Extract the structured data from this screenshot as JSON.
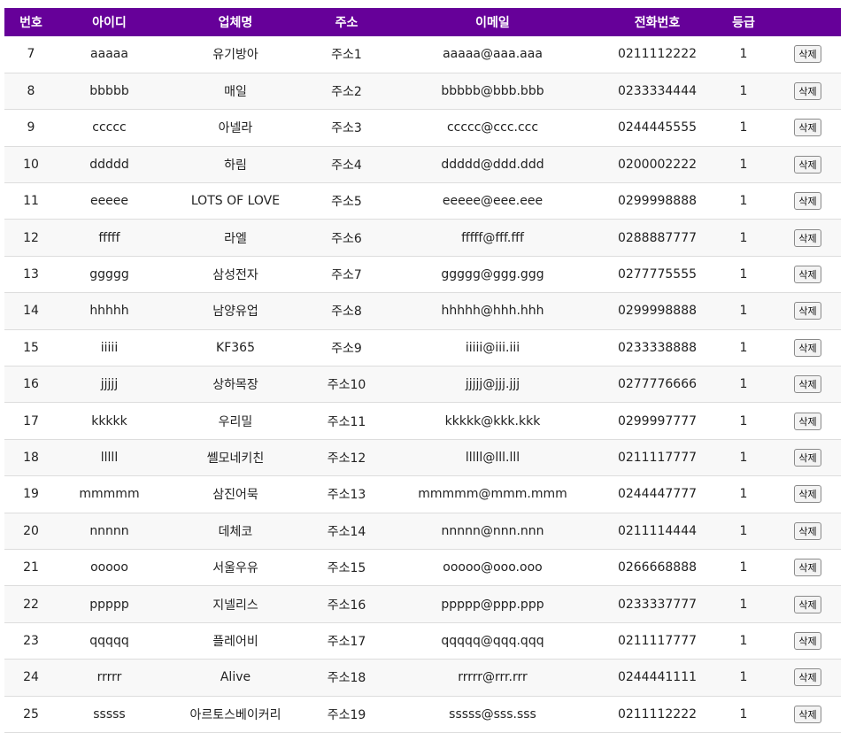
{
  "table": {
    "headers": [
      "번호",
      "아이디",
      "업체명",
      "주소",
      "이메일",
      "전화번호",
      "등급",
      ""
    ],
    "delete_label": "삭제",
    "rows": [
      {
        "no": "7",
        "id": "aaaaa",
        "company": "유기방아",
        "address": "주소1",
        "email": "aaaaa@aaa.aaa",
        "phone": "0211112222",
        "grade": "1"
      },
      {
        "no": "8",
        "id": "bbbbb",
        "company": "매일",
        "address": "주소2",
        "email": "bbbbb@bbb.bbb",
        "phone": "0233334444",
        "grade": "1"
      },
      {
        "no": "9",
        "id": "ccccc",
        "company": "아넬라",
        "address": "주소3",
        "email": "ccccc@ccc.ccc",
        "phone": "0244445555",
        "grade": "1"
      },
      {
        "no": "10",
        "id": "ddddd",
        "company": "하림",
        "address": "주소4",
        "email": "ddddd@ddd.ddd",
        "phone": "0200002222",
        "grade": "1"
      },
      {
        "no": "11",
        "id": "eeeee",
        "company": "LOTS OF LOVE",
        "address": "주소5",
        "email": "eeeee@eee.eee",
        "phone": "0299998888",
        "grade": "1"
      },
      {
        "no": "12",
        "id": "fffff",
        "company": "라엘",
        "address": "주소6",
        "email": "fffff@fff.fff",
        "phone": "0288887777",
        "grade": "1"
      },
      {
        "no": "13",
        "id": "ggggg",
        "company": "삼성전자",
        "address": "주소7",
        "email": "ggggg@ggg.ggg",
        "phone": "0277775555",
        "grade": "1"
      },
      {
        "no": "14",
        "id": "hhhhh",
        "company": "남양유업",
        "address": "주소8",
        "email": "hhhhh@hhh.hhh",
        "phone": "0299998888",
        "grade": "1"
      },
      {
        "no": "15",
        "id": "iiiii",
        "company": "KF365",
        "address": "주소9",
        "email": "iiiii@iii.iii",
        "phone": "0233338888",
        "grade": "1"
      },
      {
        "no": "16",
        "id": "jjjjj",
        "company": "상하목장",
        "address": "주소10",
        "email": "jjjjj@jjj.jjj",
        "phone": "0277776666",
        "grade": "1"
      },
      {
        "no": "17",
        "id": "kkkkk",
        "company": "우리밀",
        "address": "주소11",
        "email": "kkkkk@kkk.kkk",
        "phone": "0299997777",
        "grade": "1"
      },
      {
        "no": "18",
        "id": "lllll",
        "company": "쎌모네키친",
        "address": "주소12",
        "email": "lllll@lll.lll",
        "phone": "0211117777",
        "grade": "1"
      },
      {
        "no": "19",
        "id": "mmmmm",
        "company": "삼진어묵",
        "address": "주소13",
        "email": "mmmmm@mmm.mmm",
        "phone": "0244447777",
        "grade": "1"
      },
      {
        "no": "20",
        "id": "nnnnn",
        "company": "데체코",
        "address": "주소14",
        "email": "nnnnn@nnn.nnn",
        "phone": "0211114444",
        "grade": "1"
      },
      {
        "no": "21",
        "id": "ooooo",
        "company": "서울우유",
        "address": "주소15",
        "email": "ooooo@ooo.ooo",
        "phone": "0266668888",
        "grade": "1"
      },
      {
        "no": "22",
        "id": "ppppp",
        "company": "지넬리스",
        "address": "주소16",
        "email": "ppppp@ppp.ppp",
        "phone": "0233337777",
        "grade": "1"
      },
      {
        "no": "23",
        "id": "qqqqq",
        "company": "플레어비",
        "address": "주소17",
        "email": "qqqqq@qqq.qqq",
        "phone": "0211117777",
        "grade": "1"
      },
      {
        "no": "24",
        "id": "rrrrr",
        "company": "Alive",
        "address": "주소18",
        "email": "rrrrr@rrr.rrr",
        "phone": "0244441111",
        "grade": "1"
      },
      {
        "no": "25",
        "id": "sssss",
        "company": "아르토스베이커리",
        "address": "주소19",
        "email": "sssss@sss.sss",
        "phone": "0211112222",
        "grade": "1"
      }
    ]
  },
  "colors": {
    "header_bg": "#660099",
    "header_text": "#ffffff",
    "row_border": "#dddddd"
  }
}
